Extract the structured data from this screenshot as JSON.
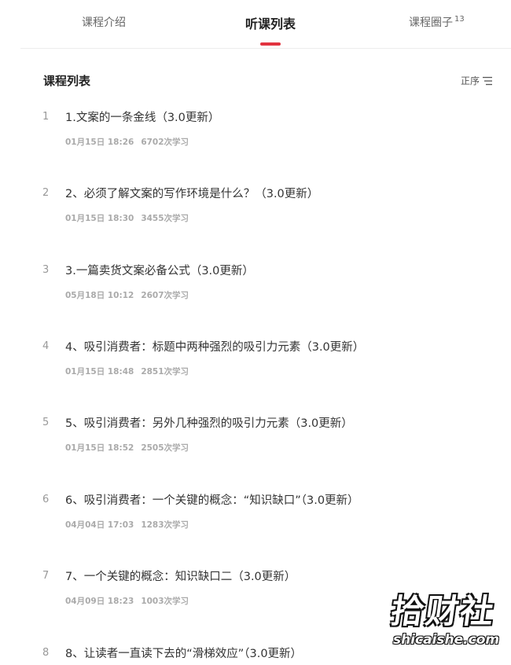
{
  "tabs": {
    "intro": "课程介绍",
    "list": "听课列表",
    "circle": "课程圈子",
    "circle_count": "13"
  },
  "section": {
    "title": "课程列表",
    "sort_label": "正序"
  },
  "lessons": [
    {
      "index": "1",
      "title": "1.文案的一条金线（3.0更新）",
      "date": "01月15日 18:26",
      "views": "6702次学习"
    },
    {
      "index": "2",
      "title": "2、必须了解文案的写作环境是什么？（3.0更新）",
      "date": "01月15日 18:30",
      "views": "3455次学习"
    },
    {
      "index": "3",
      "title": "3.一篇卖货文案必备公式（3.0更新）",
      "date": "05月18日 10:12",
      "views": "2607次学习"
    },
    {
      "index": "4",
      "title": "4、吸引消费者：标题中两种强烈的吸引力元素（3.0更新）",
      "date": "01月15日 18:48",
      "views": "2851次学习"
    },
    {
      "index": "5",
      "title": "5、吸引消费者：另外几种强烈的吸引力元素（3.0更新）",
      "date": "01月15日 18:52",
      "views": "2505次学习"
    },
    {
      "index": "6",
      "title": "6、吸引消费者：一个关键的概念：“知识缺口”（3.0更新）",
      "date": "04月04日 17:03",
      "views": "1283次学习"
    },
    {
      "index": "7",
      "title": "7、一个关键的概念：知识缺口二（3.0更新）",
      "date": "04月09日 18:23",
      "views": "1003次学习"
    },
    {
      "index": "8",
      "title": "8、让读者一直读下去的“滑梯效应”（3.0更新）",
      "date": "",
      "views": ""
    }
  ],
  "watermark": {
    "main": "拾财社",
    "sub": "shicaishe.com"
  },
  "colors": {
    "accent": "#e2333f"
  }
}
